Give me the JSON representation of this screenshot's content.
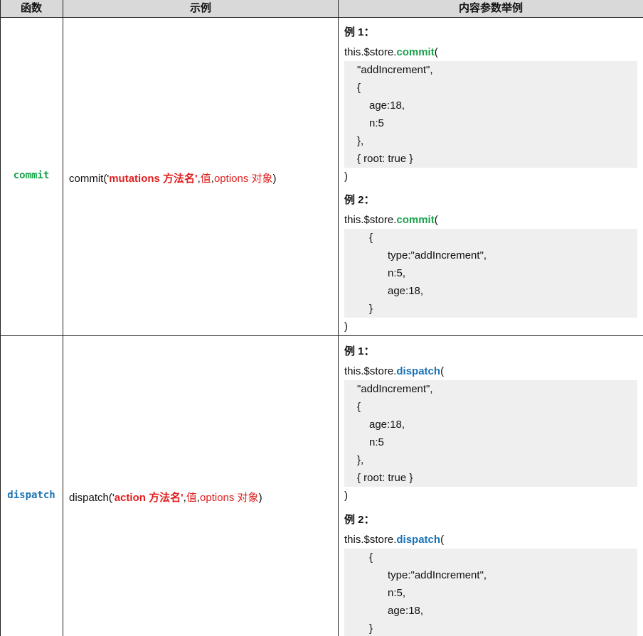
{
  "headers": {
    "func": "函数",
    "example": "示例",
    "params": "内容参数举例"
  },
  "rows": [
    {
      "fn": "commit",
      "example_prefix": "commit('",
      "example_name": "mutations 方法名'",
      "example_sep": ",",
      "example_val": "值",
      "example_comma": ",",
      "example_opts": "options 对象",
      "example_suffix": ")",
      "ex1_label": "例 1：",
      "ex1_call_prefix": "this.$store.",
      "ex1_call_method": "commit",
      "ex1_call_paren": "(",
      "ex1_code": [
        "\"addIncrement\",",
        "{",
        "age:18,",
        "n:5",
        "},",
        "{ root: true }"
      ],
      "ex1_close": ")",
      "ex2_label": "例 2：",
      "ex2_call_prefix": "this.$store.",
      "ex2_call_method": "commit",
      "ex2_call_paren": "(",
      "ex2_code": [
        "{",
        "type:\"addIncrement\",",
        "n:5,",
        "age:18,",
        "}"
      ],
      "ex2_close": ")"
    },
    {
      "fn": "dispatch",
      "example_prefix": "dispatch('",
      "example_name": "action 方法名'",
      "example_sep": ",",
      "example_val": "值",
      "example_comma": ",",
      "example_opts": "options 对象",
      "example_suffix": ")",
      "ex1_label": "例 1：",
      "ex1_call_prefix": "this.$store.",
      "ex1_call_method": "dispatch",
      "ex1_call_paren": "(",
      "ex1_code": [
        "\"addIncrement\",",
        "{",
        "age:18,",
        "n:5",
        "},",
        "{ root: true }"
      ],
      "ex1_close": ")",
      "ex2_label": "例 2：",
      "ex2_call_prefix": "this.$store.",
      "ex2_call_method": "dispatch",
      "ex2_call_paren": "(",
      "ex2_code": [
        "{",
        "type:\"addIncrement\",",
        "n:5,",
        "age:18,",
        "}"
      ]
    }
  ],
  "colors": {
    "commit": "#1aa34a",
    "dispatch": "#1a73b5",
    "highlight": "#e02020",
    "header_bg": "#d9d9d9",
    "code_bg": "#efefef"
  }
}
